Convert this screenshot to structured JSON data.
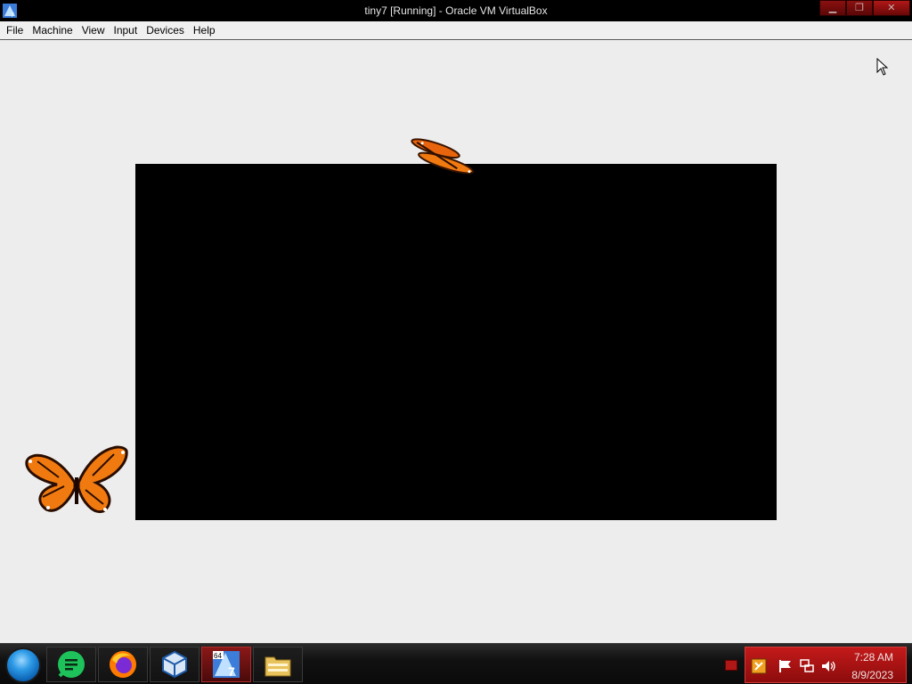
{
  "window": {
    "title": "tiny7 [Running] - Oracle VM VirtualBox",
    "minimize_glyph": "▁",
    "restore_glyph": "❐",
    "close_glyph": "✕"
  },
  "menu": {
    "items": [
      "File",
      "Machine",
      "View",
      "Input",
      "Devices",
      "Help"
    ]
  },
  "taskbar": {
    "start_icon": "start-orb-icon",
    "buttons": [
      {
        "icon": "messaging-app-icon",
        "color": "#1ec25a"
      },
      {
        "icon": "firefox-icon",
        "color": "#ff7a00"
      },
      {
        "icon": "virtualbox-icon",
        "color": "#1d5aa8"
      },
      {
        "icon": "tiny7-vm-icon",
        "color": "#3b7dd8",
        "badge": "64",
        "number": "7"
      },
      {
        "icon": "file-explorer-icon",
        "color": "#e8c25a"
      }
    ]
  },
  "tray": {
    "clock_time": "7:28 AM",
    "clock_date": "8/9/2023"
  },
  "colors": {
    "accent_red": "#c41a1a",
    "desktop_bg": "#ededed",
    "black_window": "#000000",
    "butterfly_orange": "#f07a10"
  }
}
